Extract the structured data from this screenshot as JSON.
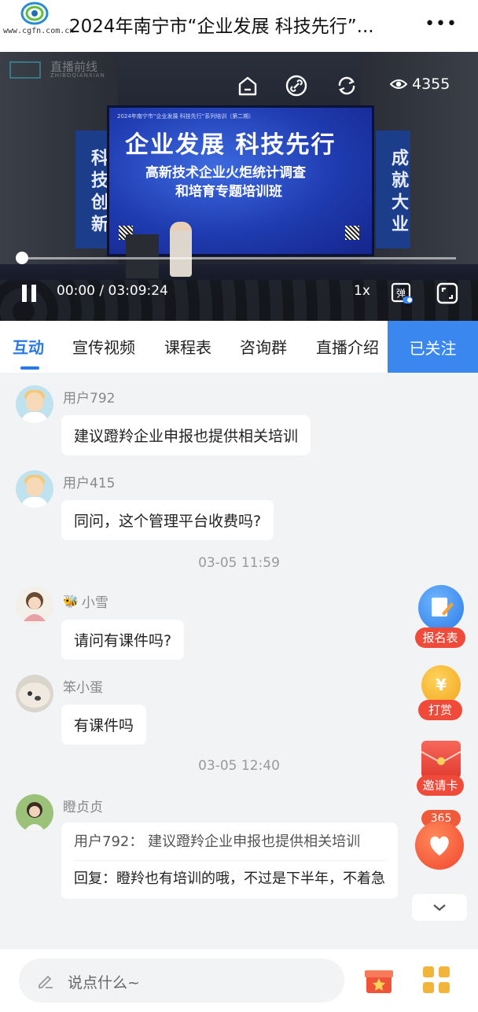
{
  "header": {
    "logo_text": "www.cgfn.com.cn",
    "title": "2024年南宁市“企业发展 科技先行”...",
    "more_icon": "more-dots-icon"
  },
  "video": {
    "watermark_title": "直播前线",
    "watermark_sub": "ZHIBOQIANXIAN",
    "banner_left": "科技创新",
    "banner_right": "成就大业",
    "screen_top": "2024年南宁市“企业发展 科技先行”系列培训（第二期）",
    "screen_heading": "企业发展  科技先行",
    "screen_line1": "高新技术企业火炬统计调查",
    "screen_line2": "和培育专题培训班",
    "view_count": "4355",
    "time": "00:00 / 03:09:24",
    "speed": "1x",
    "progress": 0.0,
    "controls": [
      "home-icon",
      "link-icon",
      "refresh-icon",
      "eye-icon",
      "pause-icon",
      "danmaku-icon",
      "fullscreen-icon"
    ]
  },
  "tabs": {
    "items": [
      "互动",
      "宣传视频",
      "课程表",
      "咨询群",
      "直播介绍"
    ],
    "active": "互动",
    "follow_label": "已关注",
    "accent": "#2a78e4"
  },
  "messages": [
    {
      "user": "用户792",
      "text": "建议蹬羚企业申报也提供相关培训"
    },
    {
      "user": "用户415",
      "text": "同问，这个管理平台收费吗?"
    },
    {
      "time": "03-05 11:59"
    },
    {
      "user": "小雪",
      "text": "请问有课件吗?"
    },
    {
      "user": "笨小蛋",
      "text": "有课件吗"
    },
    {
      "time": "03-05 12:40"
    },
    {
      "user": "瞪贞贞",
      "quote": "用户792：  建议蹬羚企业申报也提供相关培训",
      "reply": "回复：瞪羚也有培训的哦，不过是下半年，不着急"
    }
  ],
  "floating": {
    "signup_label": "报名表",
    "reward_label": "打赏",
    "reward_coin": "¥",
    "invite_label": "邀请卡",
    "like_count": "365",
    "scroll_icon": "chevron-down-icon"
  },
  "bottom": {
    "input_placeholder": "说点什么~",
    "gift_icon": "gift-icon",
    "menu_icon": "grid-icon"
  }
}
